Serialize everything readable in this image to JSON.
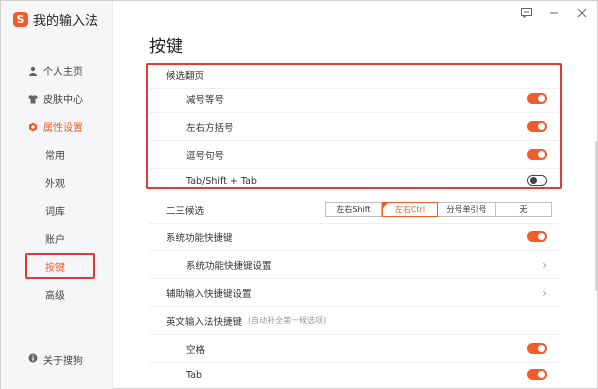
{
  "app": {
    "title": "我的输入法",
    "logo_char": "S"
  },
  "sidebar": {
    "items": [
      {
        "label": "个人主页",
        "icon": "person-icon"
      },
      {
        "label": "皮肤中心",
        "icon": "shirt-icon"
      },
      {
        "label": "属性设置",
        "icon": "settings-icon",
        "active": true
      }
    ],
    "subitems": [
      {
        "label": "常用"
      },
      {
        "label": "外观"
      },
      {
        "label": "词库"
      },
      {
        "label": "账户"
      },
      {
        "label": "按键",
        "active": true
      },
      {
        "label": "高级"
      }
    ],
    "about": "关于搜狗"
  },
  "page": {
    "title": "按键"
  },
  "candidate_paging": {
    "header": "候选翻页",
    "options": [
      {
        "label": "减号等号",
        "on": true
      },
      {
        "label": "左右方括号",
        "on": true
      },
      {
        "label": "逗号句号",
        "on": true
      },
      {
        "label": "Tab/Shift + Tab",
        "on": false
      }
    ]
  },
  "second_third": {
    "label": "二三候选",
    "choices": [
      "左右Shift",
      "左右Ctrl",
      "分号单引号",
      "无"
    ],
    "selected": "左右Ctrl"
  },
  "system_shortcut": {
    "label": "系统功能快捷键",
    "on": true,
    "settings_label": "系统功能快捷键设置"
  },
  "aux_input": {
    "label": "辅助输入快捷键设置"
  },
  "english_shortcut": {
    "label": "英文输入法快捷键",
    "note": "(自动补全第一候选项)",
    "options": [
      {
        "label": "空格",
        "on": true
      },
      {
        "label": "Tab",
        "on": true
      }
    ]
  },
  "colors": {
    "accent": "#f25c2a",
    "highlight_border": "#e53935"
  }
}
